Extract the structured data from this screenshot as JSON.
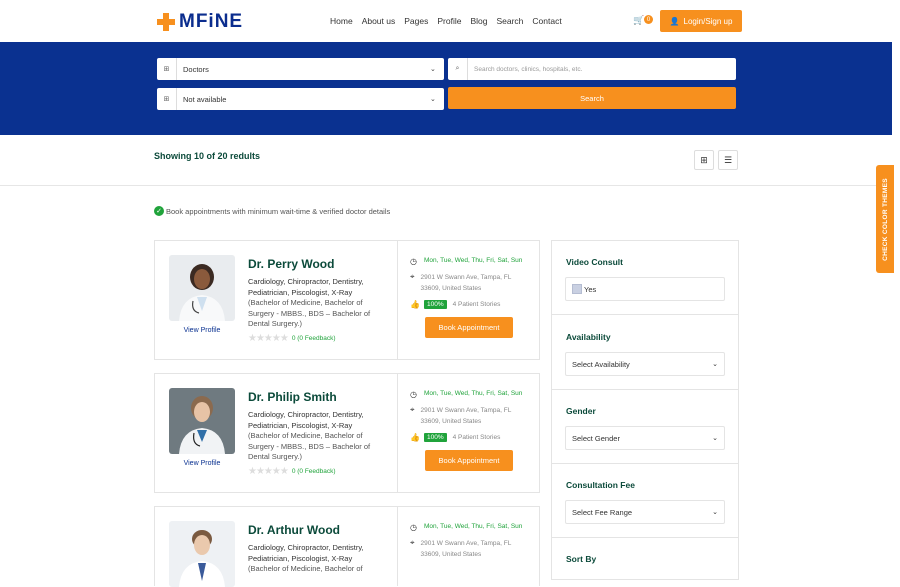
{
  "brand": {
    "name": "MFiNE"
  },
  "nav": [
    "Home",
    "About us",
    "Pages",
    "Profile",
    "Blog",
    "Search",
    "Contact"
  ],
  "cart": {
    "count": "0"
  },
  "login_label": "Login/Sign up",
  "search": {
    "category": "Doctors",
    "availability": "Not available",
    "placeholder": "Search doctors, clinics, hospitals, etc.",
    "button": "Search"
  },
  "results": {
    "showing": "Showing 10 of 20 redults"
  },
  "notice": "Book appointments with minimum wait-time & verified doctor details",
  "doctors": [
    {
      "name": "Dr. Perry Wood",
      "specialties": "Cardiology, Chiropractor, Dentistry, Pediatrician, Piscologist, X-Ray",
      "degree": "(Bachelor of Medicine, Bachelor of Surgery - MBBS., BDS – Bachelor of Dental Surgery.)",
      "feedback": "0 (0 Feedback)",
      "view_profile": "View Profile",
      "days": "Mon, Tue, Wed, Thu, Fri, Sat, Sun",
      "address": "2901 W Swann Ave, Tampa, FL 33609, United States",
      "rating_pct": "100%",
      "stories": "4 Patient Stories",
      "book": "Book Appointment",
      "photo_bg": "#e9ecef"
    },
    {
      "name": "Dr. Philip Smith",
      "specialties": "Cardiology, Chiropractor, Dentistry, Pediatrician, Piscologist, X-Ray",
      "degree": "(Bachelor of Medicine, Bachelor of Surgery - MBBS., BDS – Bachelor of Dental Surgery.)",
      "feedback": "0 (0 Feedback)",
      "view_profile": "View Profile",
      "days": "Mon, Tue, Wed, Thu, Fri, Sat, Sun",
      "address": "2901 W Swann Ave, Tampa, FL 33609, United States",
      "rating_pct": "100%",
      "stories": "4 Patient Stories",
      "book": "Book Appointment",
      "photo_bg": "#6f7a80"
    },
    {
      "name": "Dr. Arthur Wood",
      "specialties": "Cardiology, Chiropractor, Dentistry, Pediatrician, Piscologist, X-Ray",
      "degree": "(Bachelor of Medicine, Bachelor of",
      "days": "Mon, Tue, Wed, Thu, Fri, Sat, Sun",
      "address": "2901 W Swann Ave, Tampa, FL 33609, United States",
      "photo_bg": "#eef1f4"
    }
  ],
  "sidebar": {
    "video_consult": {
      "title": "Video Consult",
      "option": "Yes"
    },
    "availability": {
      "title": "Availability",
      "value": "Select Availability"
    },
    "gender": {
      "title": "Gender",
      "value": "Select Gender"
    },
    "fee": {
      "title": "Consultation Fee",
      "value": "Select Fee Range"
    },
    "sort": {
      "title": "Sort By"
    }
  },
  "theme_tab": "CHECK COLOR THEMES",
  "colors": {
    "primary": "#0a3190",
    "accent": "#f7901e",
    "success": "#20a33b"
  }
}
